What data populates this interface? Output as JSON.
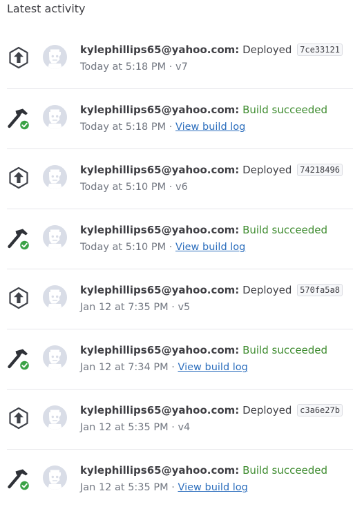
{
  "section": {
    "title": "Latest activity"
  },
  "activities": [
    {
      "type": "deploy",
      "user": "kylephillips65@yahoo.com:",
      "action": "Deployed",
      "commit": "7ce33121",
      "time": "Today at 5:18 PM",
      "separator": "·",
      "version": "v7",
      "link": ""
    },
    {
      "type": "build",
      "user": "kylephillips65@yahoo.com:",
      "action": "Build succeeded",
      "commit": "",
      "time": "Today at 5:18 PM",
      "separator": "·",
      "version": "",
      "link": "View build log"
    },
    {
      "type": "deploy",
      "user": "kylephillips65@yahoo.com:",
      "action": "Deployed",
      "commit": "74218496",
      "time": "Today at 5:10 PM",
      "separator": "·",
      "version": "v6",
      "link": ""
    },
    {
      "type": "build",
      "user": "kylephillips65@yahoo.com:",
      "action": "Build succeeded",
      "commit": "",
      "time": "Today at 5:10 PM",
      "separator": "·",
      "version": "",
      "link": "View build log"
    },
    {
      "type": "deploy",
      "user": "kylephillips65@yahoo.com:",
      "action": "Deployed",
      "commit": "570fa5a8",
      "time": "Jan 12 at 7:35 PM",
      "separator": "·",
      "version": "v5",
      "link": ""
    },
    {
      "type": "build",
      "user": "kylephillips65@yahoo.com:",
      "action": "Build succeeded",
      "commit": "",
      "time": "Jan 12 at 7:34 PM",
      "separator": "·",
      "version": "",
      "link": "View build log"
    },
    {
      "type": "deploy",
      "user": "kylephillips65@yahoo.com:",
      "action": "Deployed",
      "commit": "c3a6e27b",
      "time": "Jan 12 at 5:35 PM",
      "separator": "·",
      "version": "v4",
      "link": ""
    },
    {
      "type": "build",
      "user": "kylephillips65@yahoo.com:",
      "action": "Build succeeded",
      "commit": "",
      "time": "Jan 12 at 5:35 PM",
      "separator": "·",
      "version": "",
      "link": "View build log"
    }
  ],
  "icons": {
    "deploy": "deploy-arrow-hexagon-icon",
    "build": "hammer-check-icon",
    "avatar": "user-avatar-icon"
  },
  "colors": {
    "text": "#3f3f44",
    "muted": "#737882",
    "success": "#3d8b2e",
    "link": "#2c6ebd",
    "divider": "#e6e6ea",
    "avatar_bg": "#d9dde7"
  }
}
